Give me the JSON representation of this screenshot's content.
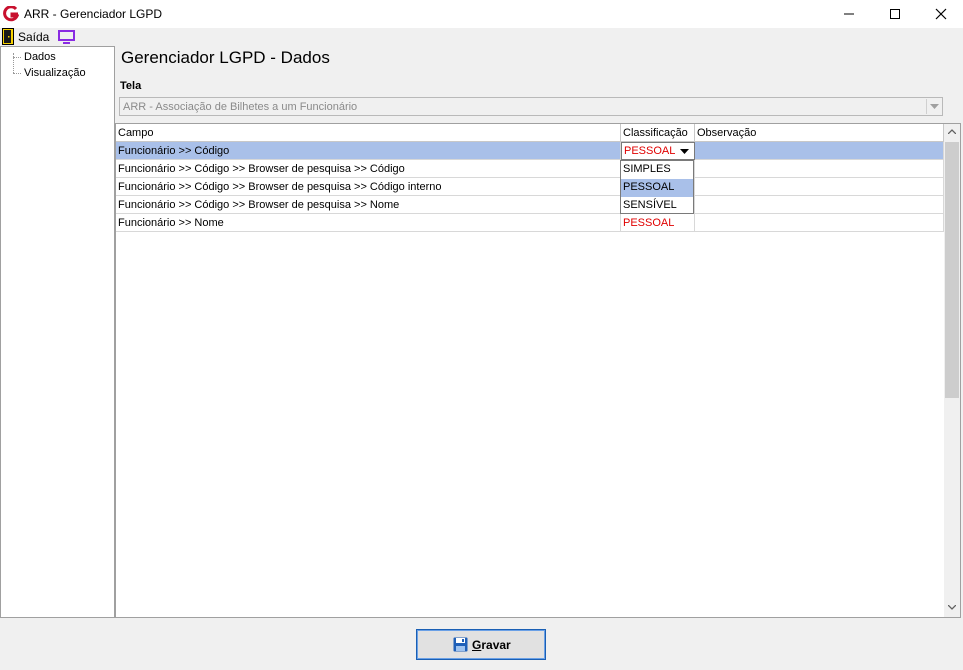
{
  "window": {
    "title": "ARR - Gerenciador LGPD"
  },
  "toolbar": {
    "exit_label": "Saída"
  },
  "tree": {
    "items": [
      {
        "label": "Dados"
      },
      {
        "label": "Visualização"
      }
    ]
  },
  "main": {
    "title": "Gerenciador LGPD - Dados",
    "tela_label": "Tela",
    "tela_value": "ARR - Associação de Bilhetes a um Funcionário"
  },
  "grid": {
    "columns": [
      "Campo",
      "Classificação",
      "Observação"
    ],
    "rows": [
      {
        "campo": "Funcionário >> Código",
        "classificacao": "PESSOAL",
        "observacao": ""
      },
      {
        "campo": "Funcionário >> Código >> Browser de pesquisa >> Código",
        "classificacao": "",
        "observacao": ""
      },
      {
        "campo": "Funcionário >> Código >> Browser de pesquisa >> Código interno",
        "classificacao": "",
        "observacao": ""
      },
      {
        "campo": "Funcionário >> Código >> Browser de pesquisa >> Nome",
        "classificacao": "",
        "observacao": ""
      },
      {
        "campo": "Funcionário >> Nome",
        "classificacao": "PESSOAL",
        "observacao": ""
      }
    ],
    "dropdown_options": [
      "SIMPLES",
      "PESSOAL",
      "SENSÍVEL"
    ],
    "dropdown_highlighted": "PESSOAL"
  },
  "actions": {
    "save_first": "G",
    "save_rest": "ravar"
  },
  "colors": {
    "selection": "#a9c0e9",
    "accent_red": "#e00000",
    "logo_red": "#c8102e"
  }
}
